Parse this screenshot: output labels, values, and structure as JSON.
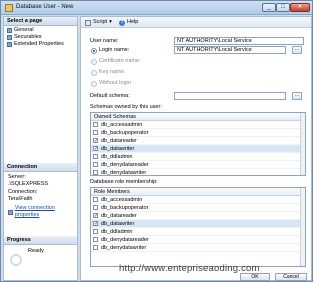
{
  "window": {
    "title": "Database User - New",
    "min_glyph": "_",
    "max_glyph": "□",
    "close_glyph": "✕"
  },
  "left": {
    "select_page_header": "Select a page",
    "pages": [
      {
        "label": "General",
        "icon": "page-icon"
      },
      {
        "label": "Securables",
        "icon": "page-icon"
      },
      {
        "label": "Extended Properties",
        "icon": "page-icon"
      }
    ],
    "connection_header": "Connection",
    "server_label": "Server:",
    "server_value": ".\\SQLEXPRESS",
    "connection_label": "Connection:",
    "connection_value": "Tera\\Faith",
    "view_link": "View connection properties",
    "progress_header": "Progress",
    "progress_status": "Ready"
  },
  "toolbar": {
    "script_label": "Script",
    "dropdown_glyph": "▾",
    "help_label": "Help",
    "help_glyph": "?"
  },
  "form": {
    "user_name_label": "User name:",
    "user_name_value": "NT AUTHORITY\\Local Service",
    "login_name_label": "Login name:",
    "login_name_value": "NT AUTHORITY\\Local Service",
    "certificate_label": "Certificate name:",
    "key_label": "Key name:",
    "without_login_label": "Without login",
    "default_schema_label": "Default schema:",
    "default_schema_value": "",
    "browse_glyph": "...",
    "schemas_label": "Schemas owned by this user:",
    "schemas_header": "Owned Schemas",
    "schemas": [
      {
        "name": "db_accessadmin",
        "checked": false
      },
      {
        "name": "db_backupoperator",
        "checked": false
      },
      {
        "name": "db_datareader",
        "checked": true
      },
      {
        "name": "db_datawriter",
        "checked": true
      },
      {
        "name": "db_ddladmin",
        "checked": false
      },
      {
        "name": "db_denydatareader",
        "checked": false
      },
      {
        "name": "db_denydatawriter",
        "checked": false
      }
    ],
    "roles_label": "Database role membership:",
    "roles_header": "Role Members",
    "roles": [
      {
        "name": "db_accessadmin",
        "checked": false
      },
      {
        "name": "db_backupoperator",
        "checked": false
      },
      {
        "name": "db_datareader",
        "checked": true
      },
      {
        "name": "db_datawriter",
        "checked": true
      },
      {
        "name": "db_ddladmin",
        "checked": false
      },
      {
        "name": "db_denydatareader",
        "checked": false
      },
      {
        "name": "db_denydatawriter",
        "checked": false
      }
    ]
  },
  "footer": {
    "ok_label": "OK",
    "cancel_label": "Cancel"
  },
  "watermark": "http://www.entepriseaoding.com",
  "colors": {
    "link": "#1c4fa8",
    "selection": "#d7e6f7",
    "frame": "#cfdcec"
  }
}
